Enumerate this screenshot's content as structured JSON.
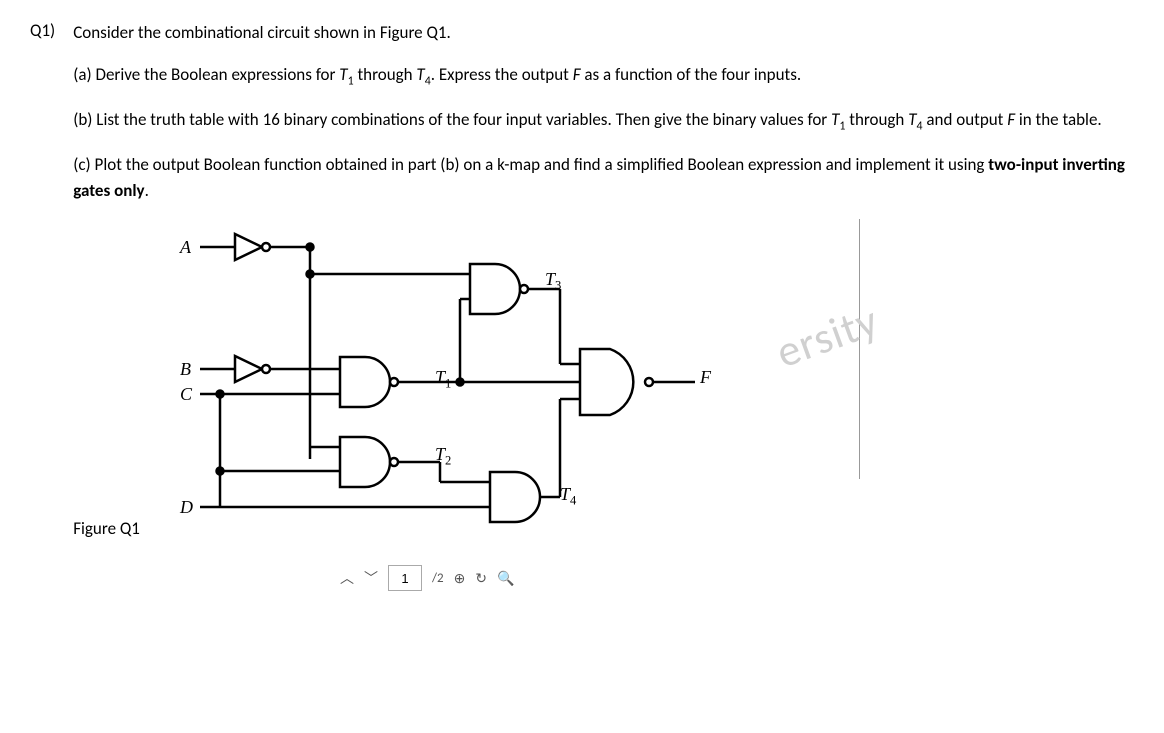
{
  "question": {
    "label": "Q1)",
    "intro": "Consider the combinational circuit shown in Figure Q1.",
    "part_a_prefix": "(a) Derive the Boolean expressions for ",
    "part_a_T1": "T",
    "part_a_T1_sub": "1",
    "part_a_mid1": " through ",
    "part_a_T4": "T",
    "part_a_T4_sub": "4",
    "part_a_mid2": ". Express the output ",
    "part_a_F": "F",
    "part_a_suffix": " as a function of the four inputs.",
    "part_b_prefix": "(b) List the truth table with 16 binary combinations of the four input variables. Then give the binary values for ",
    "part_b_T1": "T",
    "part_b_T1_sub": "1",
    "part_b_mid1": " through ",
    "part_b_T4": "T",
    "part_b_T4_sub": "4",
    "part_b_mid2": " and output ",
    "part_b_F": "F",
    "part_b_suffix": " in the table.",
    "part_c_prefix": "(c) Plot the output Boolean function obtained in part (b) on a k-map and find a simplified Boolean expression and implement it using ",
    "part_c_bold": "two-input inverting gates only",
    "part_c_suffix": "."
  },
  "circuit": {
    "inputs": {
      "A": "A",
      "B": "B",
      "C": "C",
      "D": "D"
    },
    "nodes": {
      "T1": "T",
      "T1s": "1",
      "T2": "T",
      "T2s": "2",
      "T3": "T",
      "T3s": "3",
      "T4": "T",
      "T4s": "4"
    },
    "output": "F"
  },
  "figure_caption": "Figure Q1",
  "watermark": "ersity",
  "pager": {
    "current": "1",
    "total": "/2"
  }
}
